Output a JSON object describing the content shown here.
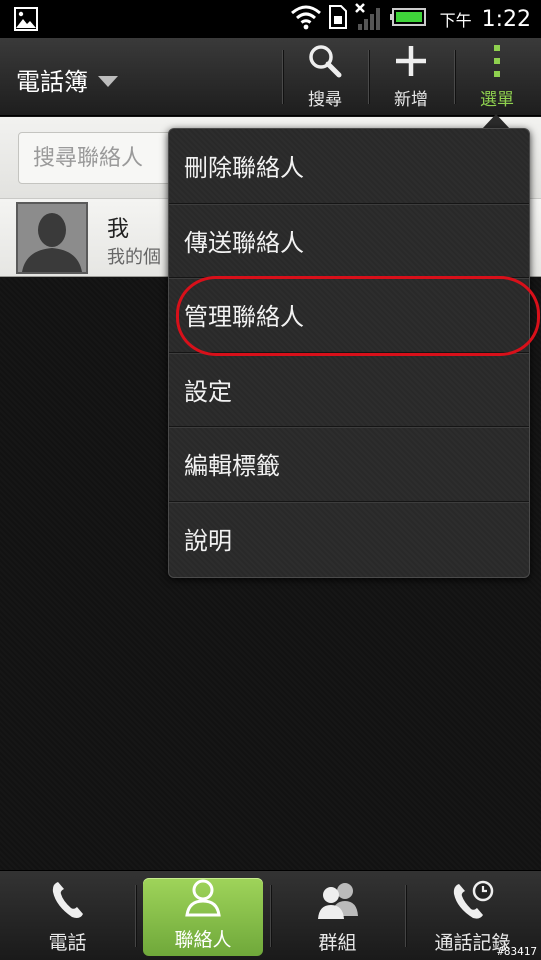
{
  "status": {
    "ampm": "下午",
    "time": "1:22"
  },
  "colors": {
    "accent_green": "#8fd14f",
    "highlight_red": "#d8101a",
    "battery_green": "#3fd43a"
  },
  "actionbar": {
    "title": "電話簿",
    "buttons": [
      {
        "label": "搜尋",
        "icon": "search-icon"
      },
      {
        "label": "新增",
        "icon": "plus-icon"
      },
      {
        "label": "選單",
        "icon": "menu-dots-icon"
      }
    ]
  },
  "search": {
    "placeholder": "搜尋聯絡人"
  },
  "me": {
    "name": "我",
    "subtitle": "我的個"
  },
  "menu": {
    "items": [
      "刪除聯絡人",
      "傳送聯絡人",
      "管理聯絡人",
      "設定",
      "編輯標籤",
      "說明"
    ]
  },
  "tabs": [
    {
      "label": "電話",
      "icon": "phone-icon"
    },
    {
      "label": "聯絡人",
      "icon": "person-icon"
    },
    {
      "label": "群組",
      "icon": "group-icon"
    },
    {
      "label": "通話記錄",
      "icon": "call-history-icon"
    }
  ],
  "watermark": "#83417"
}
